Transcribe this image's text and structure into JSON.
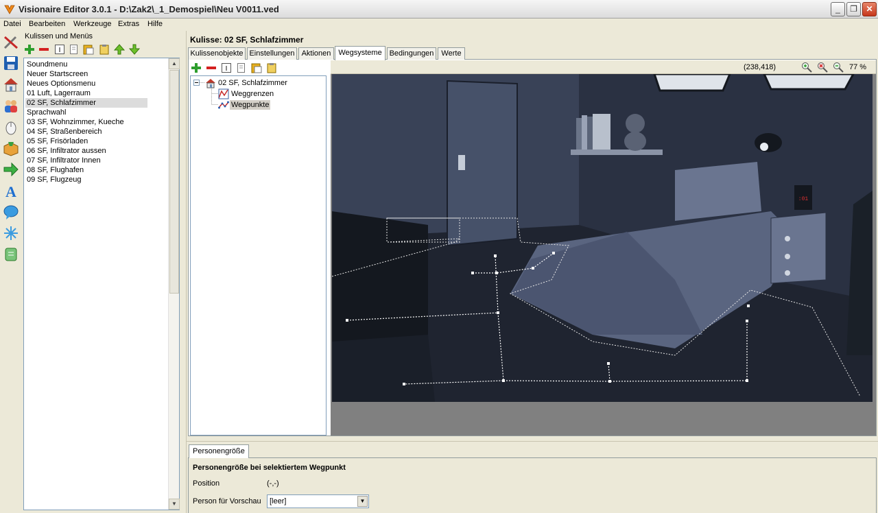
{
  "window": {
    "title": "Visionaire Editor 3.0.1 - D:\\Zak2\\_1_Demospiel\\Neu V0011.ved",
    "minimize": "_",
    "maximize": "❐",
    "close": "✕"
  },
  "menu": [
    "Datei",
    "Bearbeiten",
    "Werkzeuge",
    "Extras",
    "Hilfe"
  ],
  "left_panel": {
    "caption": "Kulissen und Menüs",
    "scenes": [
      "Soundmenu",
      "Neuer Startscreen",
      "Neues Optionsmenu",
      "01 Luft, Lagerraum",
      "02 SF, Schlafzimmer",
      "Sprachwahl",
      "03 SF, Wohnzimmer, Kueche",
      "04 SF, Straßenbereich",
      "05 SF, Frisörladen",
      "06 SF, Infiltrator aussen",
      "07 SF, Infiltrator Innen",
      "08 SF, Flughafen",
      "09 SF, Flugzeug"
    ],
    "selected_scene": "02 SF, Schlafzimmer",
    "scroll_up": "▲",
    "scroll_down": "▼"
  },
  "scene_header": "Kulisse: 02 SF, Schlafzimmer",
  "tabs": [
    "Kulissenobjekte",
    "Einstellungen",
    "Aktionen",
    "Wegsysteme",
    "Bedingungen",
    "Werte"
  ],
  "active_tab": "Wegsysteme",
  "tree": {
    "root": "02 SF, Schlafzimmer",
    "children": [
      "Weggrenzen",
      "Wegpunkte"
    ],
    "selected": "Wegpunkte",
    "expander": "−"
  },
  "canvas": {
    "coordinates": "(238,418)",
    "zoom": "77 %"
  },
  "bottom": {
    "tab": "Personengröße",
    "heading": "Personengröße bei selektiertem Wegpunkt",
    "position_label": "Position",
    "position_value": "(-,-)",
    "preview_label": "Person für Vorschau",
    "preview_value": "[leer]",
    "dropdown_arrow": "▼"
  },
  "colors": {
    "accent_green": "#2e9e2e",
    "accent_red": "#d42020",
    "scene_dark": "#2f3545",
    "waypoint": "#ffffff"
  }
}
